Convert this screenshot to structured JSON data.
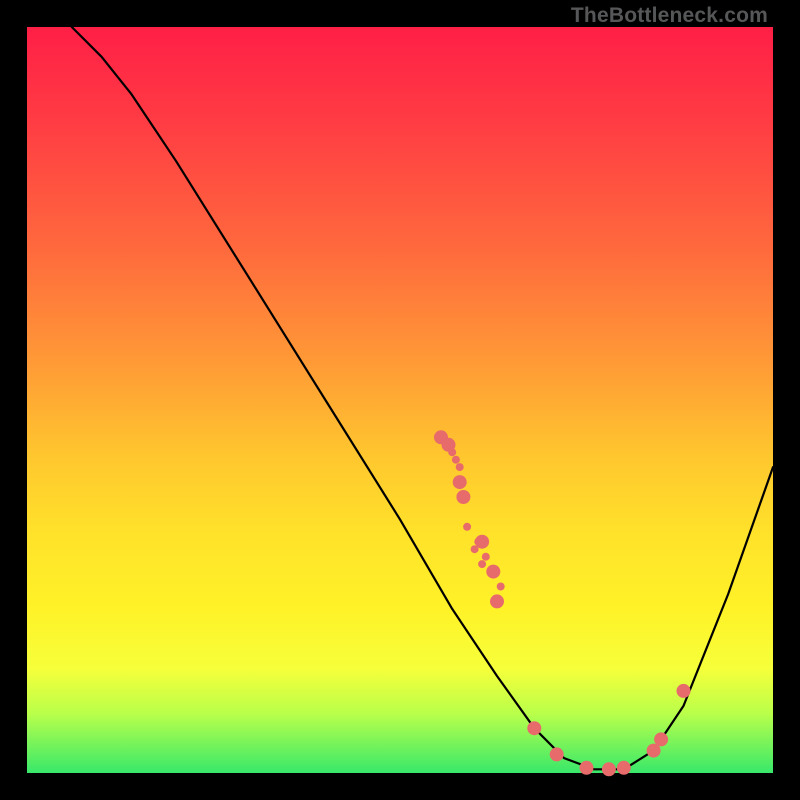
{
  "watermark": "TheBottleneck.com",
  "chart_data": {
    "type": "line",
    "title": "",
    "xlabel": "",
    "ylabel": "",
    "xlim": [
      0,
      100
    ],
    "ylim": [
      0,
      100
    ],
    "grid": false,
    "curve": {
      "name": "bottleneck-curve",
      "points": [
        {
          "x": 6,
          "y": 100
        },
        {
          "x": 10,
          "y": 96
        },
        {
          "x": 14,
          "y": 91
        },
        {
          "x": 20,
          "y": 82
        },
        {
          "x": 30,
          "y": 66
        },
        {
          "x": 40,
          "y": 50
        },
        {
          "x": 50,
          "y": 34
        },
        {
          "x": 57,
          "y": 22
        },
        {
          "x": 63,
          "y": 13
        },
        {
          "x": 68,
          "y": 6
        },
        {
          "x": 72,
          "y": 2
        },
        {
          "x": 76,
          "y": 0.5
        },
        {
          "x": 80,
          "y": 0.5
        },
        {
          "x": 84,
          "y": 3
        },
        {
          "x": 88,
          "y": 9
        },
        {
          "x": 94,
          "y": 24
        },
        {
          "x": 100,
          "y": 41
        }
      ]
    },
    "markers": {
      "name": "highlight-dots",
      "color": "#e86b6b",
      "points_small": [
        {
          "x": 57,
          "y": 43
        },
        {
          "x": 57.5,
          "y": 42
        },
        {
          "x": 58,
          "y": 41
        },
        {
          "x": 60.5,
          "y": 31
        },
        {
          "x": 61.5,
          "y": 29
        },
        {
          "x": 61,
          "y": 28
        },
        {
          "x": 63.5,
          "y": 25
        },
        {
          "x": 63,
          "y": 23
        },
        {
          "x": 59,
          "y": 33
        },
        {
          "x": 60,
          "y": 30
        }
      ],
      "points_large": [
        {
          "x": 55.5,
          "y": 45
        },
        {
          "x": 56.5,
          "y": 44
        },
        {
          "x": 58,
          "y": 39
        },
        {
          "x": 58.5,
          "y": 37
        },
        {
          "x": 61,
          "y": 31
        },
        {
          "x": 62.5,
          "y": 27
        },
        {
          "x": 63,
          "y": 23
        },
        {
          "x": 68,
          "y": 6
        },
        {
          "x": 71,
          "y": 2.5
        },
        {
          "x": 75,
          "y": 0.7
        },
        {
          "x": 78,
          "y": 0.5
        },
        {
          "x": 80,
          "y": 0.7
        },
        {
          "x": 84,
          "y": 3
        },
        {
          "x": 85,
          "y": 4.5
        },
        {
          "x": 88,
          "y": 11
        }
      ]
    }
  }
}
